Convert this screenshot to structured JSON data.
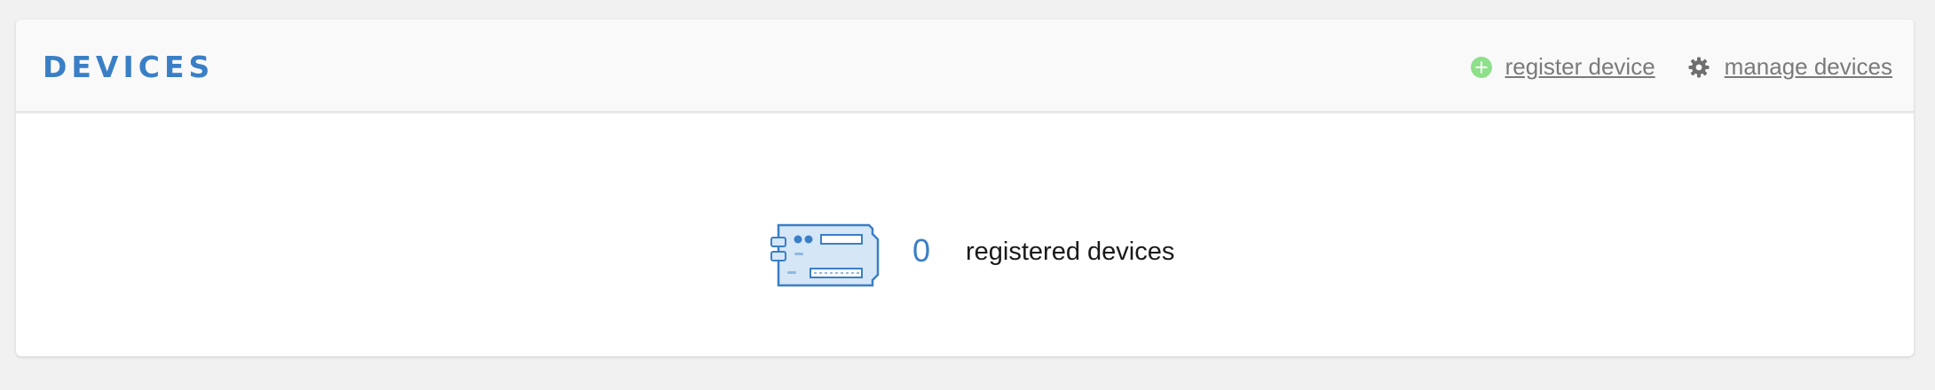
{
  "header": {
    "title": "DEVICES",
    "actions": [
      {
        "label": "register device",
        "icon": "plus-circle-icon",
        "icon_color": "#8ee08a"
      },
      {
        "label": "manage devices",
        "icon": "gear-icon",
        "icon_color": "#6f6f6f"
      }
    ]
  },
  "summary": {
    "count": "0",
    "label": "registered devices",
    "icon": "circuit-board-icon"
  },
  "colors": {
    "accent": "#3a7fc6",
    "link": "#7a7a7a",
    "background": "#f1f1f1",
    "card": "#ffffff"
  }
}
